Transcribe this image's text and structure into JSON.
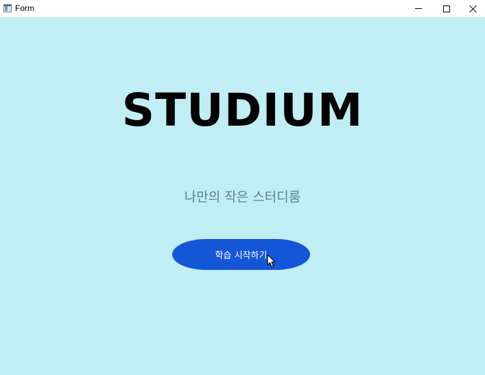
{
  "window": {
    "title": "Form",
    "colors": {
      "background": "#c0eef4",
      "accent": "#1357d8"
    }
  },
  "main": {
    "headline": "STUDIUM",
    "subtitle": "나만의 작은 스터디룸",
    "start_button_label": "학습 시작하기"
  },
  "icons": [
    "app-icon",
    "minimize-icon",
    "maximize-icon",
    "close-icon",
    "mouse-cursor"
  ]
}
